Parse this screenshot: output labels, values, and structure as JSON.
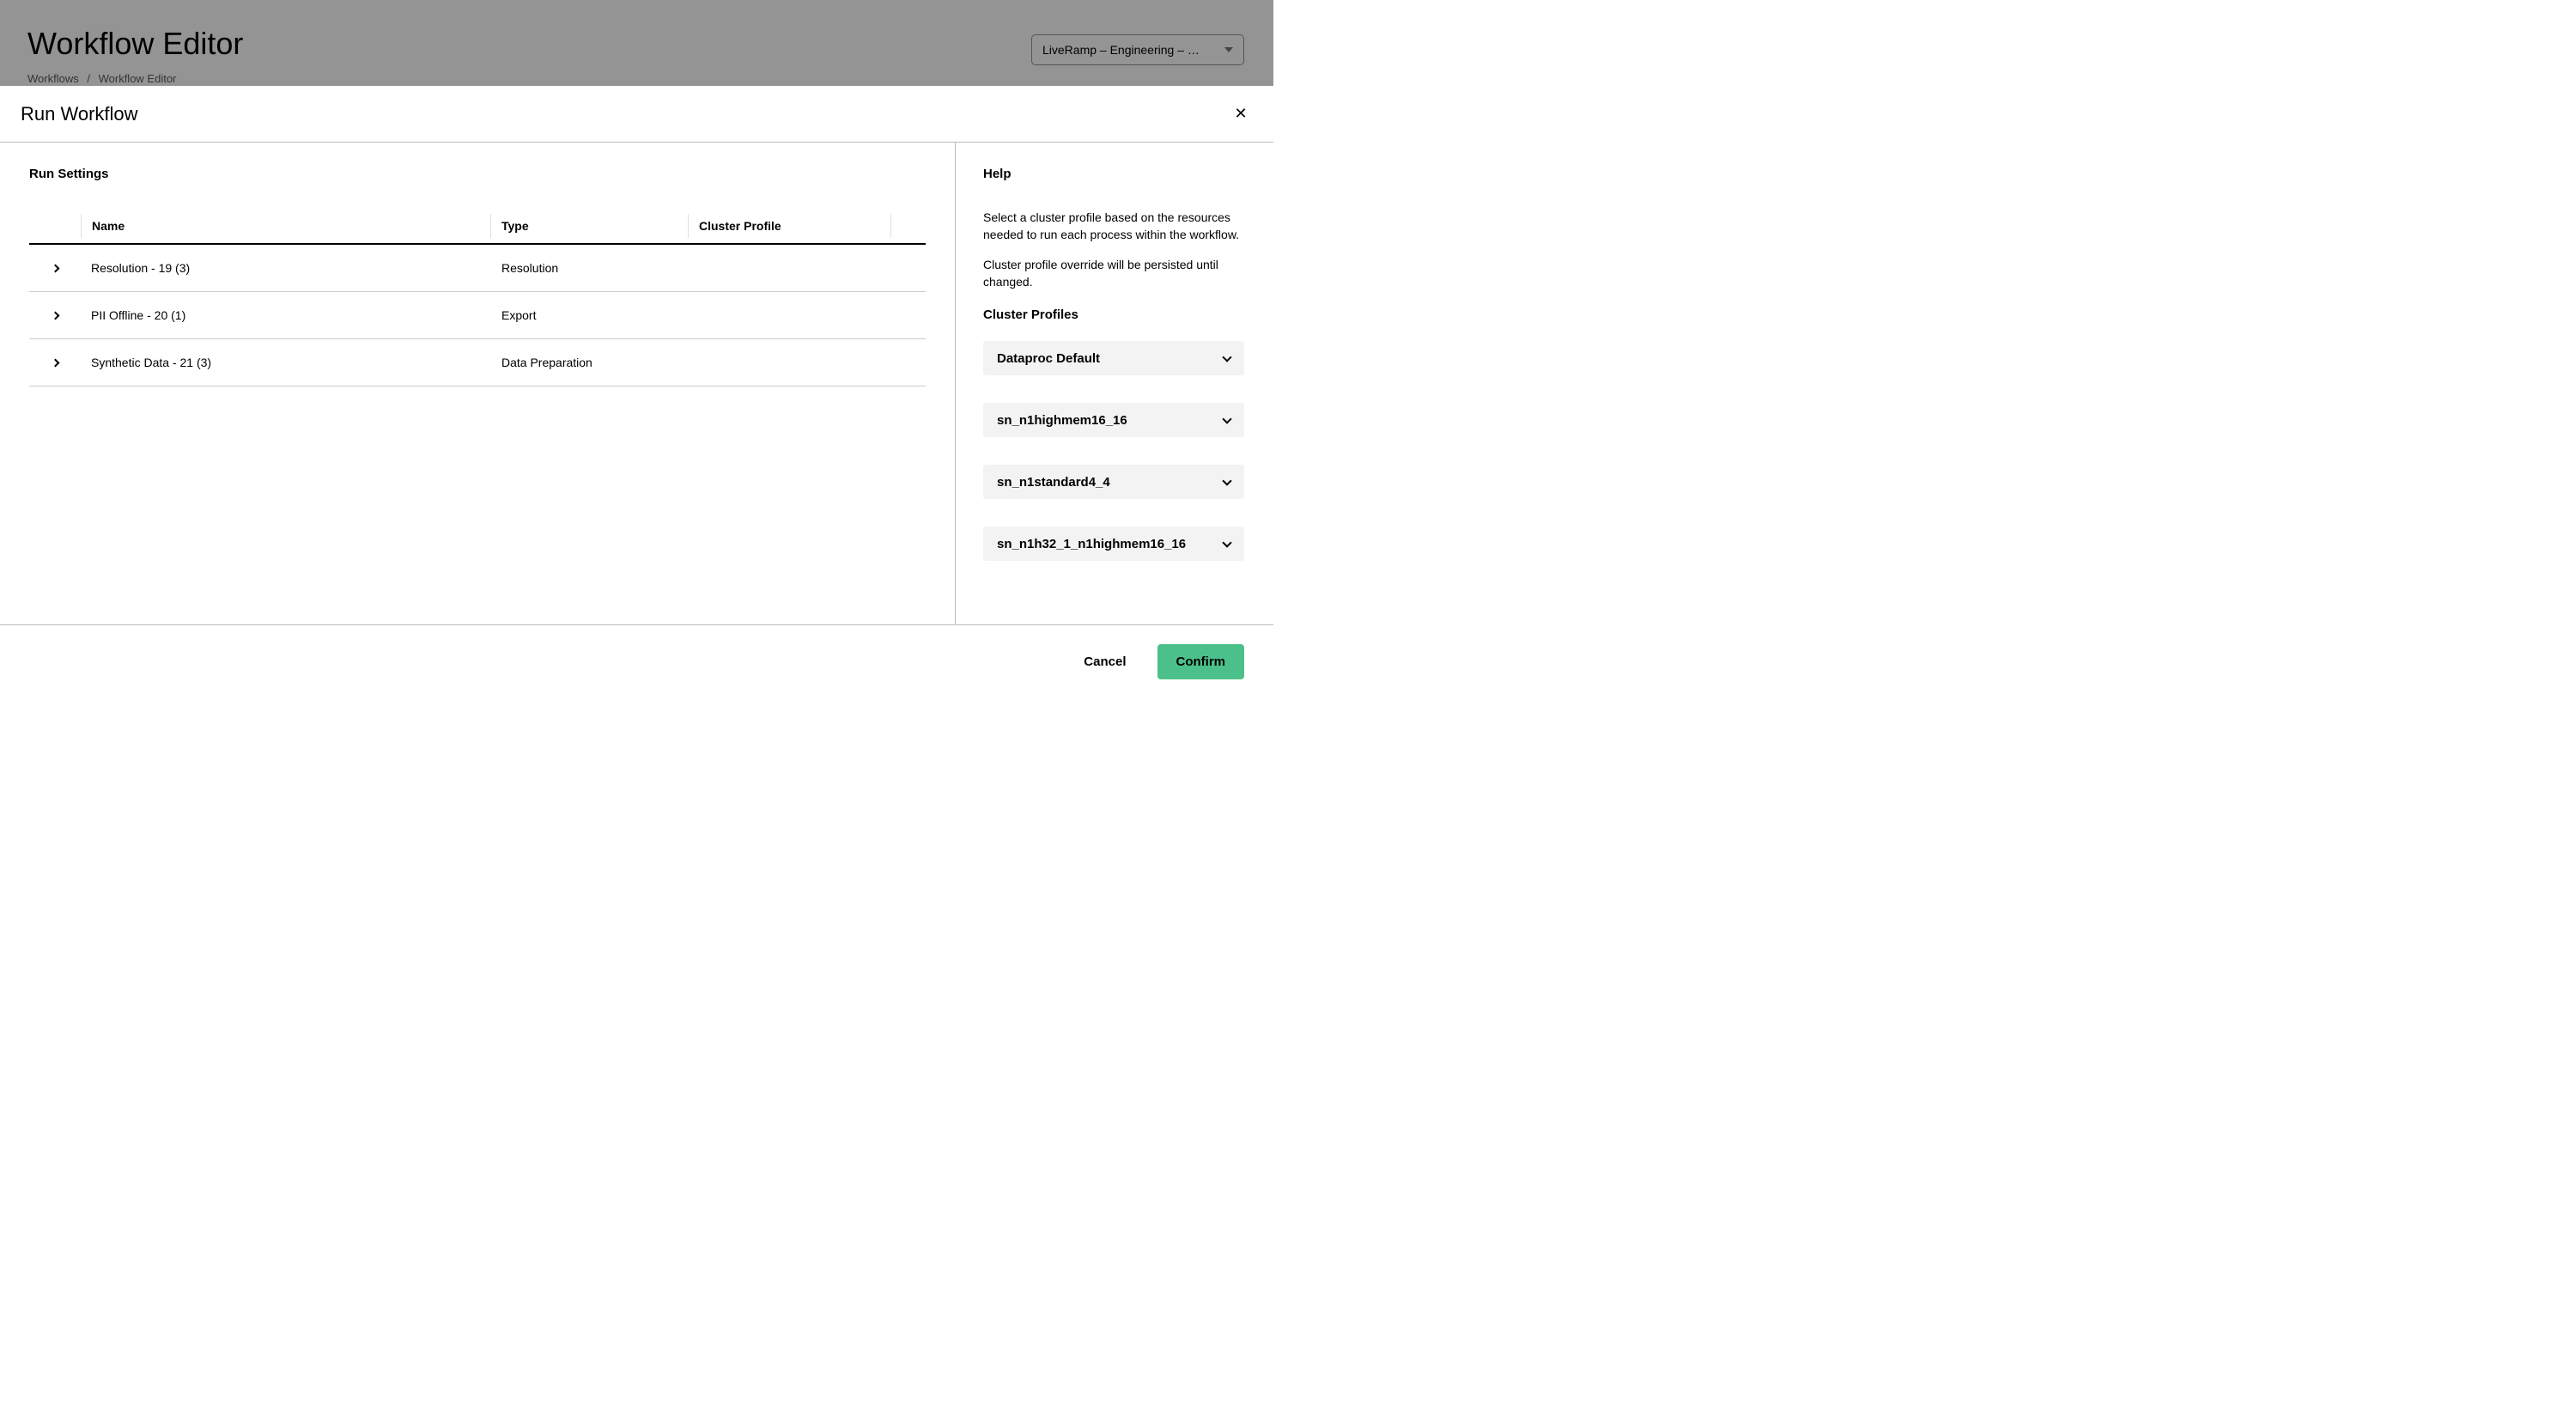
{
  "page": {
    "title": "Workflow Editor",
    "breadcrumb": {
      "root": "Workflows",
      "separator": "/",
      "current": "Workflow Editor"
    },
    "project_picker": "LiveRamp – Engineering – …"
  },
  "modal": {
    "title": "Run Workflow",
    "left": {
      "heading": "Run Settings",
      "columns": {
        "name": "Name",
        "type": "Type",
        "profile": "Cluster Profile"
      },
      "rows": [
        {
          "name": "Resolution - 19 (3)",
          "type": "Resolution",
          "profile": ""
        },
        {
          "name": "PII Offline - 20 (1)",
          "type": "Export",
          "profile": ""
        },
        {
          "name": "Synthetic Data - 21 (3)",
          "type": "Data Preparation",
          "profile": ""
        }
      ]
    },
    "help": {
      "heading": "Help",
      "p1": "Select a cluster profile based on the resources needed to run each process within the workflow.",
      "p2": "Cluster profile override will be persisted until changed.",
      "profiles_heading": "Cluster Profiles",
      "profiles": [
        "Dataproc Default",
        "sn_n1highmem16_16",
        "sn_n1standard4_4",
        "sn_n1h32_1_n1highmem16_16"
      ]
    },
    "footer": {
      "cancel": "Cancel",
      "confirm": "Confirm"
    }
  }
}
